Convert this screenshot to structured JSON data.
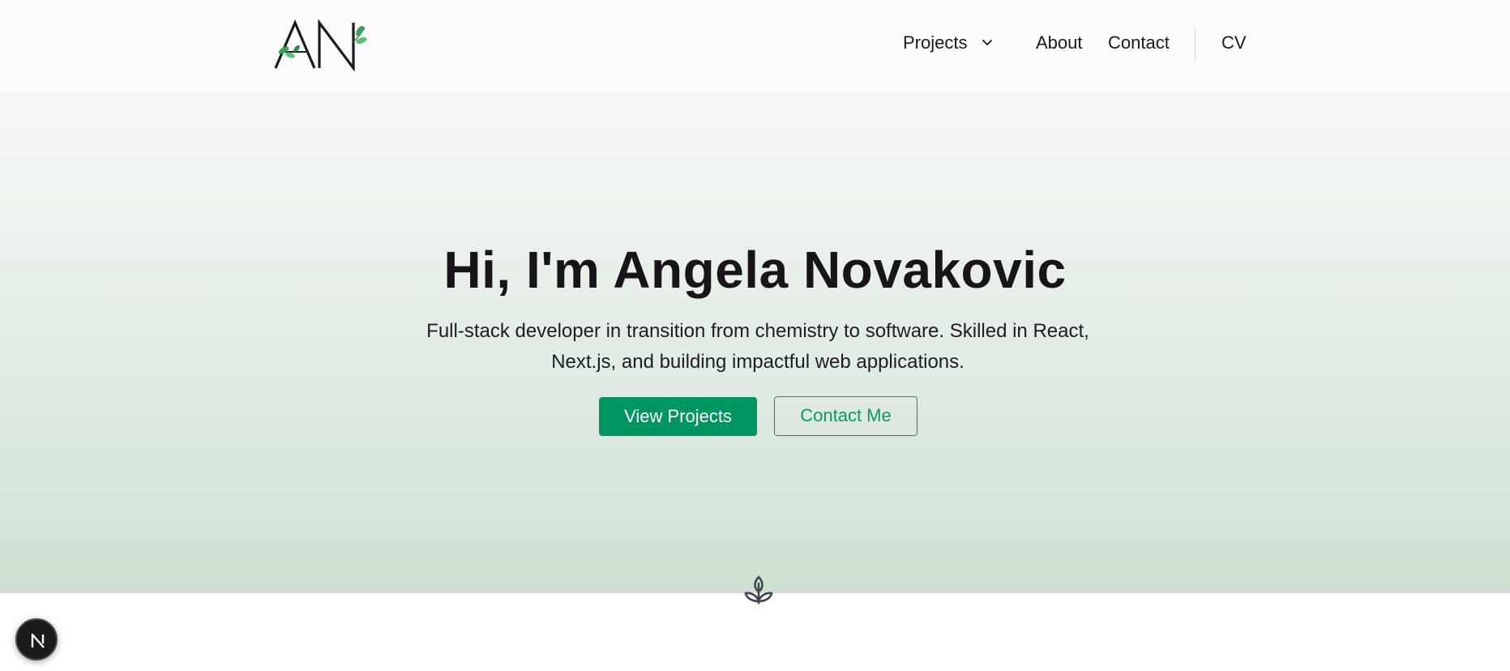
{
  "header": {
    "logo_text": "AN",
    "nav": {
      "projects_label": "Projects",
      "about_label": "About",
      "contact_label": "Contact",
      "cv_label": "CV"
    }
  },
  "hero": {
    "title": "Hi, I'm Angela Novakovic",
    "subtitle": "Full-stack developer in transition from chemistry to software. Skilled in React, Next.js, and building impactful web applications.",
    "primary_button": "View Projects",
    "secondary_button": "Contact Me"
  },
  "icons": {
    "chevron": "chevron-down-icon",
    "sprout": "sprout-icon",
    "next_badge": "nextjs-logo-icon"
  },
  "colors": {
    "accent": "#009661",
    "hero_top": "#f6f8f5",
    "hero_bottom": "#cfe0d3",
    "text": "#161616"
  }
}
